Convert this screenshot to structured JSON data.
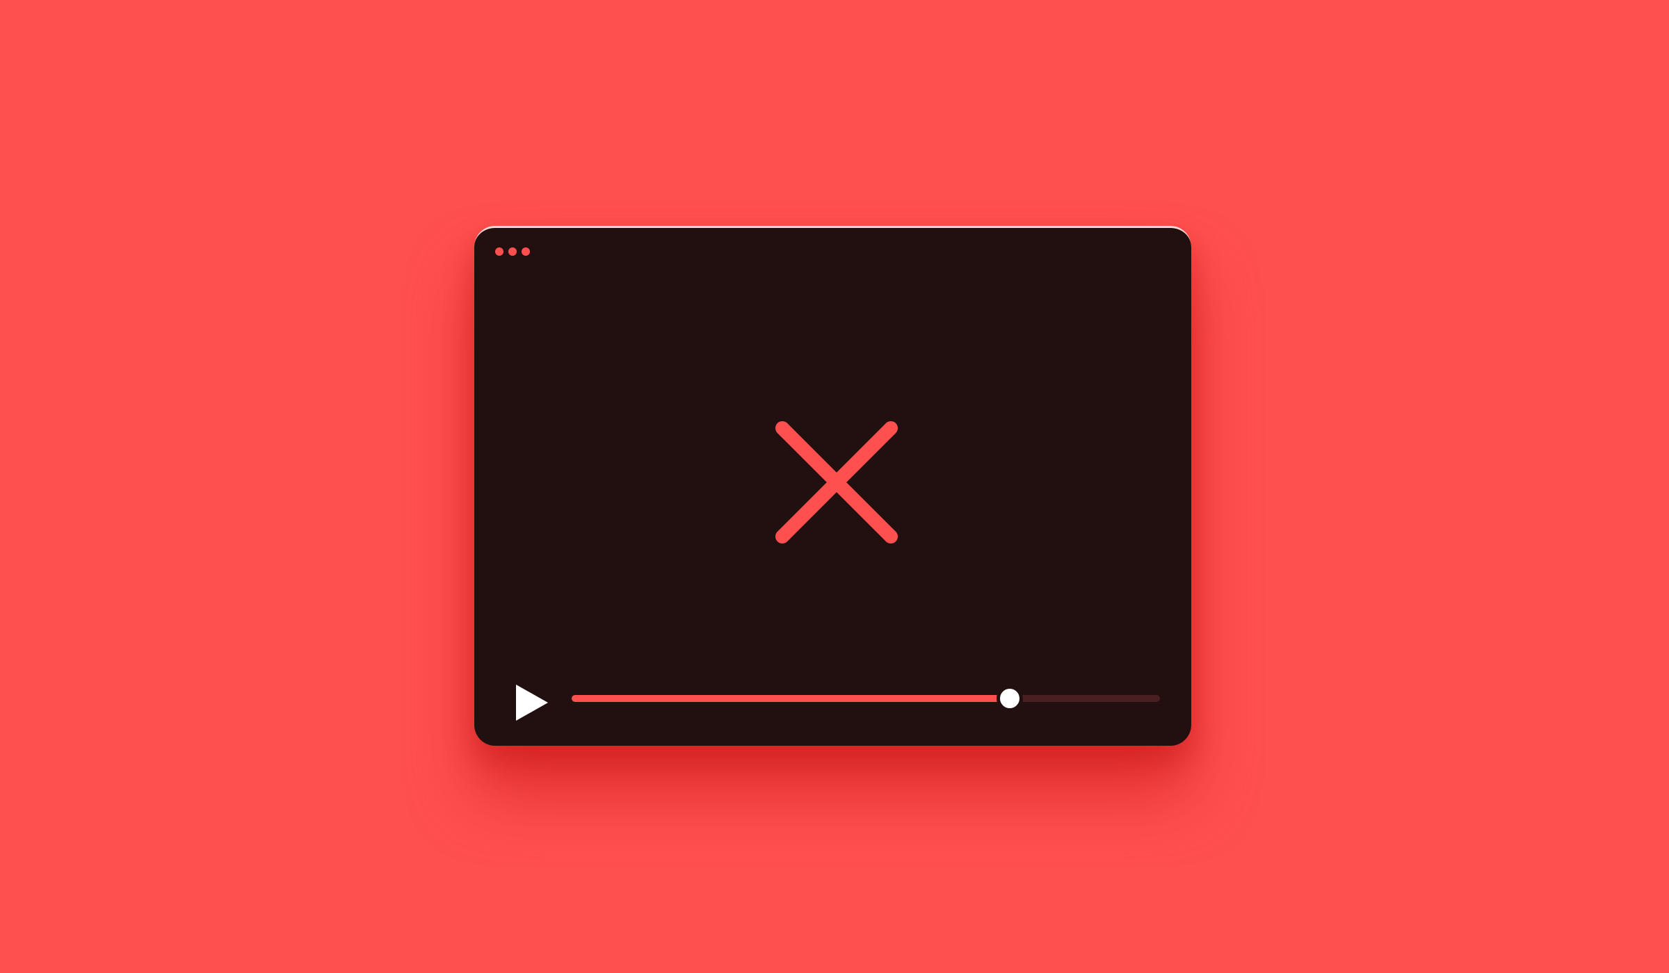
{
  "background_color": "#FF5050",
  "player": {
    "frame_color": "#220F0F",
    "accent_color": "#FF5050",
    "window_controls": [
      "dot",
      "dot",
      "dot"
    ],
    "center_icon": "close-icon",
    "play_icon": "play-icon",
    "progress": {
      "played_fraction": 0.745,
      "played_color": "#FF5050",
      "remaining_color": "#4A1F21",
      "thumb_color": "#FFFFFF"
    }
  }
}
